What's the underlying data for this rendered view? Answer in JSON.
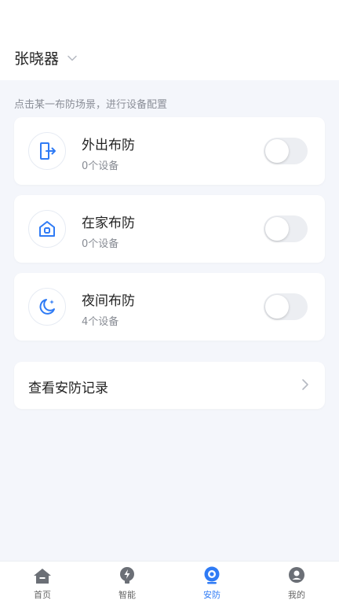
{
  "header": {
    "home_name": "张晓器"
  },
  "hint": "点击某一布防场景，进行设备配置",
  "scenes": [
    {
      "title": "外出布防",
      "subtitle": "0个设备",
      "icon": "exit-door-icon",
      "enabled": false
    },
    {
      "title": "在家布防",
      "subtitle": "0个设备",
      "icon": "home-icon",
      "enabled": false
    },
    {
      "title": "夜间布防",
      "subtitle": "4个设备",
      "icon": "moon-icon",
      "enabled": false
    }
  ],
  "record": {
    "label": "查看安防记录"
  },
  "tabs": [
    {
      "label": "首页",
      "icon": "home-tab-icon",
      "active": false
    },
    {
      "label": "智能",
      "icon": "lightning-icon",
      "active": false
    },
    {
      "label": "安防",
      "icon": "camera-icon",
      "active": true
    },
    {
      "label": "我的",
      "icon": "profile-icon",
      "active": false
    }
  ],
  "colors": {
    "accent": "#2f7bf5",
    "tab_inactive": "#666666",
    "toggle_off": "#eceef2"
  }
}
